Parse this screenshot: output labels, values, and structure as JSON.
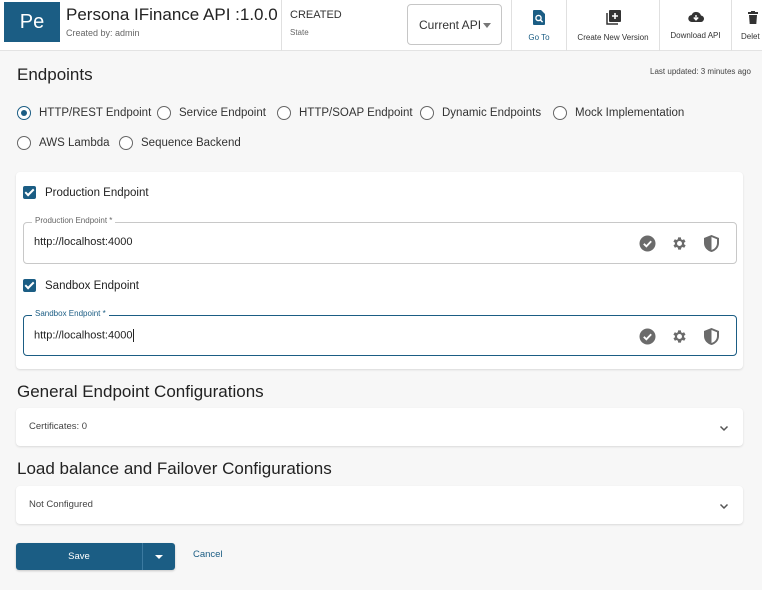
{
  "header": {
    "avatar_initials": "Pe",
    "api_title": "Persona IFinance API :1.0.0",
    "created_by": "Created by: admin",
    "state_value": "CREATED",
    "state_label": "State",
    "version_select": "Current API",
    "actions": {
      "goto": "Go To",
      "create_new_version": "Create New Version",
      "download_api": "Download API",
      "delete": "Delet"
    }
  },
  "endpoints": {
    "heading": "Endpoints",
    "last_updated": "Last updated: 3 minutes ago",
    "types": [
      "HTTP/REST Endpoint",
      "Service Endpoint",
      "HTTP/SOAP Endpoint",
      "Dynamic Endpoints",
      "Mock Implementation",
      "AWS Lambda",
      "Sequence Backend"
    ],
    "selected_type": "HTTP/REST Endpoint",
    "production": {
      "checkbox_label": "Production Endpoint",
      "field_label": "Production Endpoint *",
      "value": "http://localhost:4000"
    },
    "sandbox": {
      "checkbox_label": "Sandbox Endpoint",
      "field_label": "Sandbox Endpoint *",
      "value": "http://localhost:4000"
    }
  },
  "general": {
    "heading": "General Endpoint Configurations",
    "certificates": "Certificates: 0"
  },
  "loadbalance": {
    "heading": "Load balance and Failover Configurations",
    "status": "Not Configured"
  },
  "footer": {
    "save": "Save",
    "cancel": "Cancel"
  },
  "colors": {
    "primary": "#1b5d84",
    "background": "#f7f7f7",
    "icon_gray": "#6b6b6b"
  },
  "icons": [
    "search-doc-icon",
    "new-version-icon",
    "cloud-download-icon",
    "trash-icon",
    "check-circle-icon",
    "gear-icon",
    "shield-icon",
    "chevron-down-icon"
  ]
}
